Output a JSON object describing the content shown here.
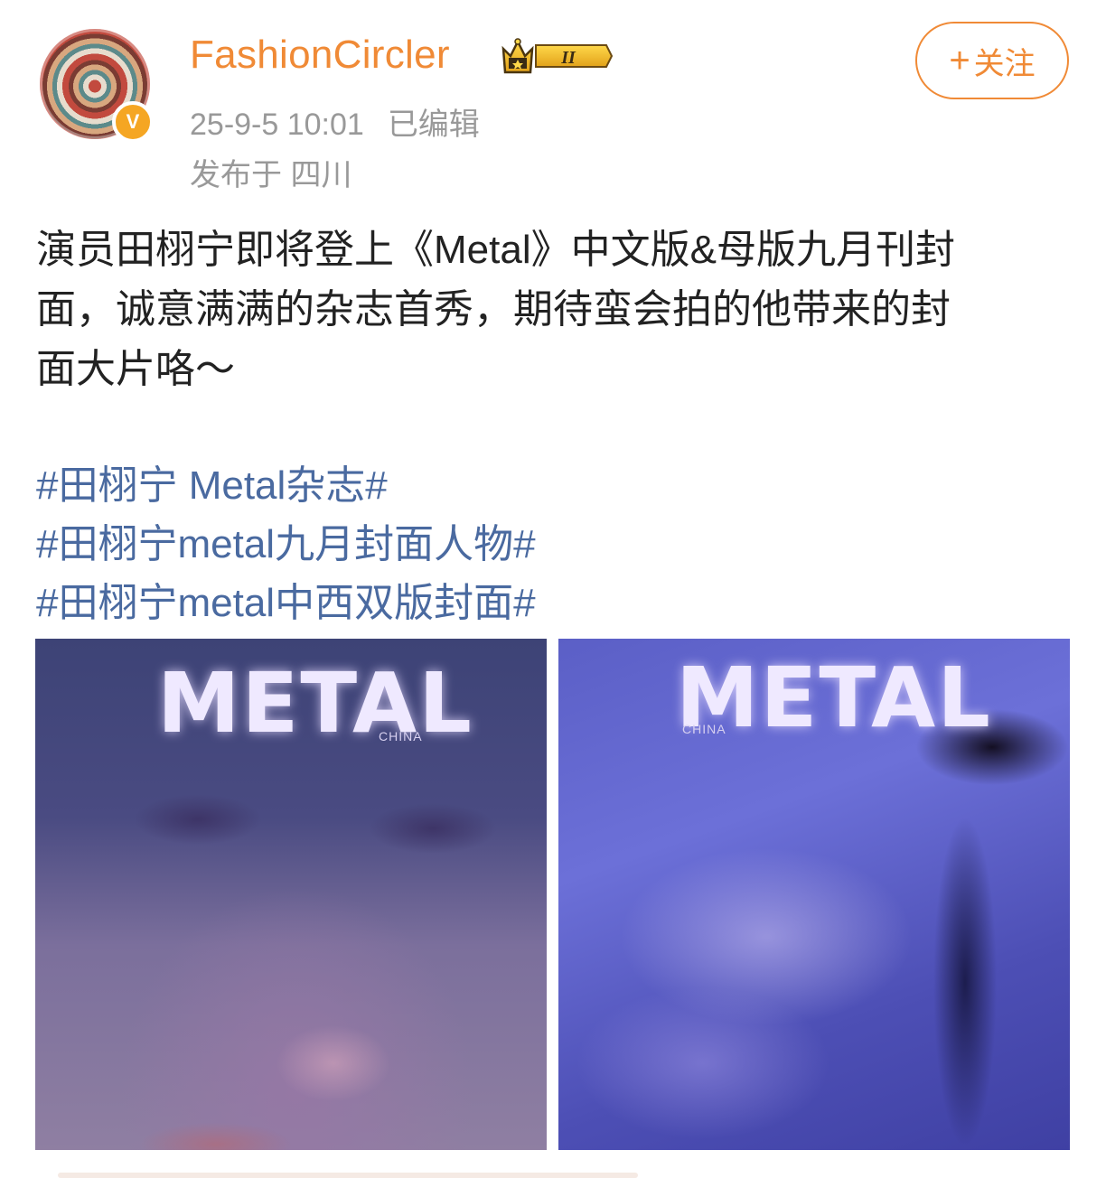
{
  "post": {
    "author": {
      "name": "FashionCircler",
      "verified_badge": "V",
      "level_badge": "II"
    },
    "timestamp": "25-9-5 10:01",
    "edited_label": "已编辑",
    "location": "发布于 四川",
    "follow_button": {
      "plus": "+",
      "label": "关注"
    },
    "content_lines": [
      "演员田栩宁即将登上《Metal》中文版&母版九月刊封",
      "面，诚意满满的杂志首秀，期待蛮会拍的他带来的封",
      "面大片咯～"
    ],
    "hashtags": [
      "#田栩宁 Metal杂志#",
      "#田栩宁metal九月封面人物#",
      "#田栩宁metal中西双版封面#"
    ],
    "images": [
      {
        "logo": "METAL",
        "sub": "CHINA"
      },
      {
        "logo": "METAL",
        "sub": "CHINA"
      }
    ]
  },
  "colors": {
    "accent": "#f08a36",
    "hashtag": "#4a6aa0",
    "meta": "#999999"
  },
  "icons": {
    "crown": "crown-level-icon",
    "verified": "verified-v-icon"
  }
}
